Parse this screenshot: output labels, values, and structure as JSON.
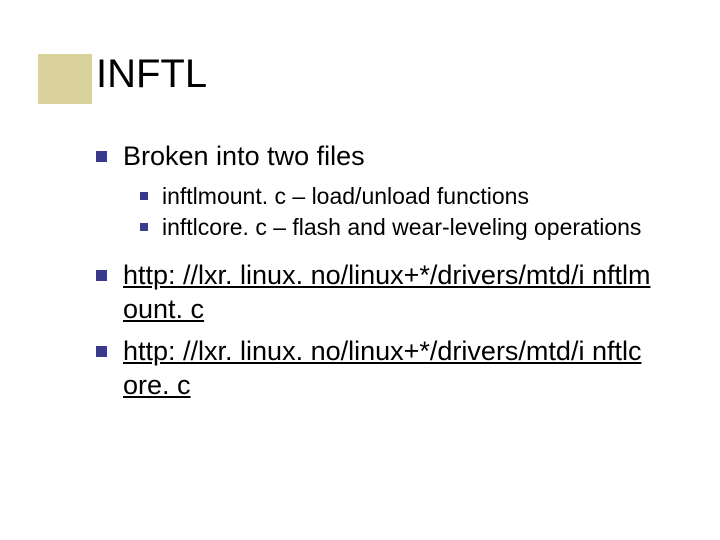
{
  "title": "INFTL",
  "bullets": {
    "l1_0": "Broken into two files",
    "l2_0": "inftlmount. c – load/unload functions",
    "l2_1": "inftlcore. c – flash and wear-leveling operations",
    "l1_1": "http: //lxr. linux. no/linux+*/drivers/mtd/i nftlmount. c",
    "l1_2": "http: //lxr. linux. no/linux+*/drivers/mtd/i nftlcore. c"
  }
}
